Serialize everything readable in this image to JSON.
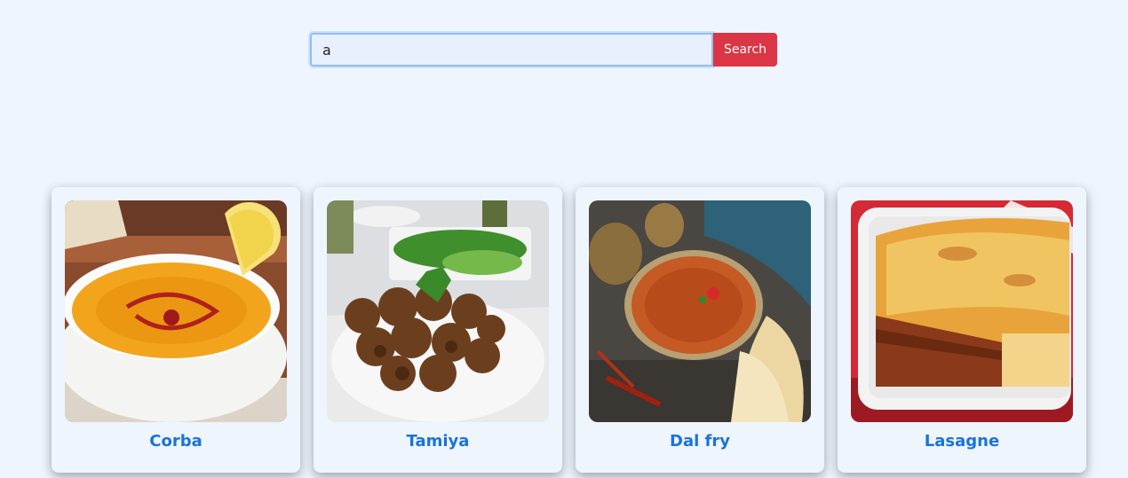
{
  "search": {
    "value": "a",
    "button_label": "Search"
  },
  "meals": [
    {
      "name": "Corba",
      "image": "lentil-soup-photo"
    },
    {
      "name": "Tamiya",
      "image": "falafel-photo"
    },
    {
      "name": "Dal fry",
      "image": "dal-fry-photo"
    },
    {
      "name": "Lasagne",
      "image": "lasagne-photo"
    }
  ],
  "colors": {
    "background": "#eef5fd",
    "button": "#dc3545",
    "title": "#1a73d9"
  }
}
